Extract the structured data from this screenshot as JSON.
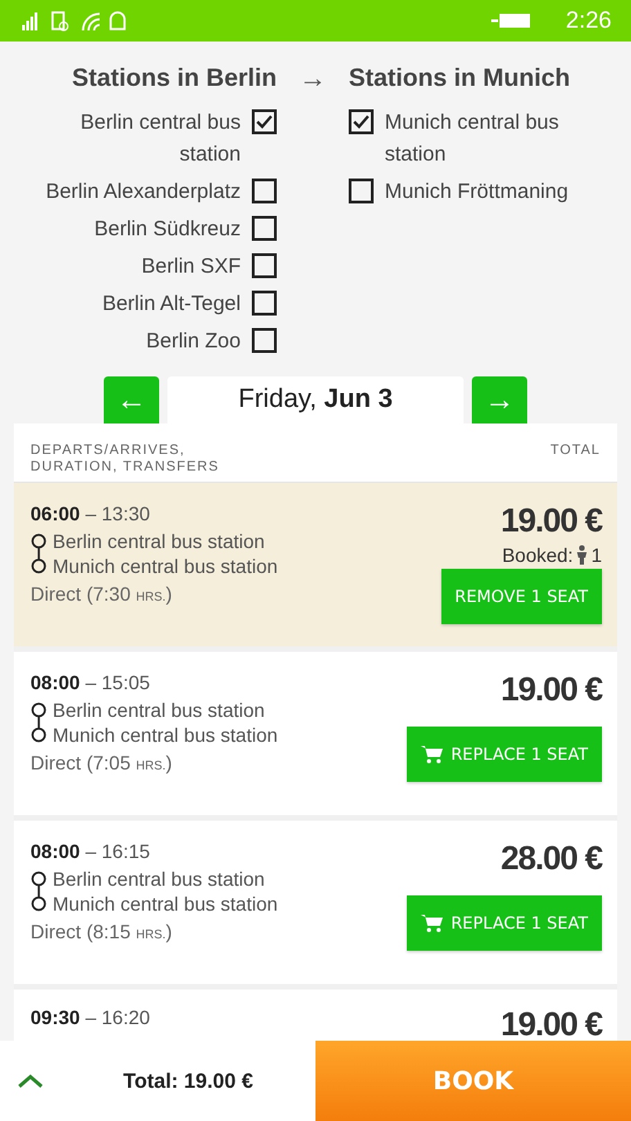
{
  "status_bar": {
    "time": "2:26"
  },
  "stations": {
    "from_title": "Stations in Berlin",
    "arrow": "→",
    "to_title": "Stations in Munich",
    "from": [
      {
        "label": "Berlin central bus station",
        "checked": true
      },
      {
        "label": "Berlin Alexanderplatz",
        "checked": false
      },
      {
        "label": "Berlin Südkreuz",
        "checked": false
      },
      {
        "label": "Berlin SXF",
        "checked": false
      },
      {
        "label": "Berlin Alt-Tegel",
        "checked": false
      },
      {
        "label": "Berlin Zoo",
        "checked": false
      }
    ],
    "to": [
      {
        "label": "Munich central bus station",
        "checked": true
      },
      {
        "label": "Munich Fröttmaning",
        "checked": false
      }
    ]
  },
  "date_nav": {
    "prev": "←",
    "date": "Friday, **Jun 3**",
    "next": "→"
  },
  "list_header": {
    "left": "DEPARTS/ARRIVES, DURATION, TRANSFERS",
    "right": "TOTAL"
  },
  "trips": [
    {
      "depart": "06:00",
      "separator": "–",
      "arrive": "13:30",
      "from": "Berlin central bus station",
      "to": "Munich central bus station",
      "duration": "Direct (7:30",
      "unit": "HRS.",
      "close": ")",
      "price": "19.00 €",
      "selected": true,
      "booked": {
        "label": "Booked:",
        "count": "1"
      },
      "button": {
        "kind": "remove",
        "label": "REMOVE 1 SEAT"
      }
    },
    {
      "depart": "08:00",
      "separator": "–",
      "arrive": "15:05",
      "from": "Berlin central bus station",
      "to": "Munich central bus station",
      "duration": "Direct (7:05",
      "unit": "HRS.",
      "close": ")",
      "price": "19.00 €",
      "selected": false,
      "button": {
        "kind": "replace",
        "label": "REPLACE 1 SEAT"
      }
    },
    {
      "depart": "08:00",
      "separator": "–",
      "arrive": "16:15",
      "from": "Berlin central bus station",
      "to": "Munich central bus station",
      "duration": "Direct (8:15",
      "unit": "HRS.",
      "close": ")",
      "price": "28.00 €",
      "selected": false,
      "button": {
        "kind": "replace",
        "label": "REPLACE 1 SEAT"
      }
    },
    {
      "depart": "09:30",
      "separator": "–",
      "arrive": "16:20",
      "price": "19.00 €",
      "selected": false
    }
  ],
  "footer": {
    "total": "Total: 19.00 €",
    "book": "BOOK"
  }
}
